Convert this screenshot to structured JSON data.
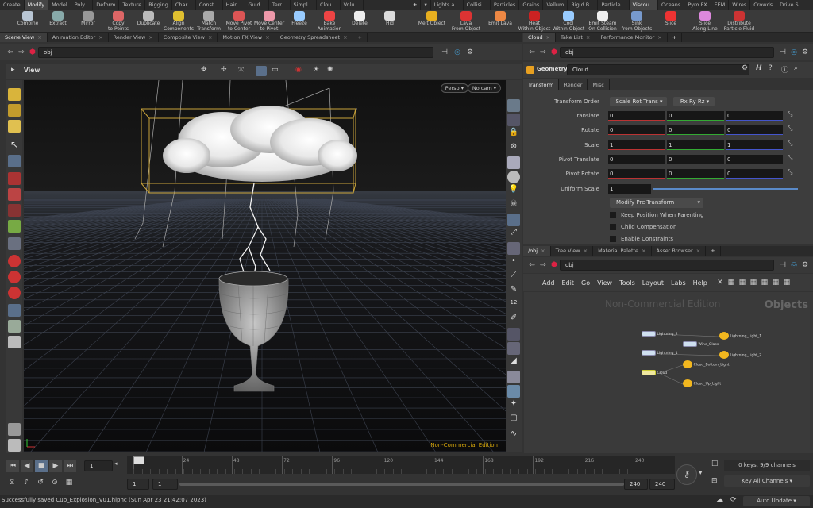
{
  "shelf": {
    "tabs_left": [
      "Create",
      "Modify",
      "Model",
      "Poly...",
      "Deform",
      "Texture",
      "Rigging",
      "Char...",
      "Const...",
      "Hair...",
      "Guid...",
      "Terr...",
      "Simpl...",
      "Clou...",
      "Volu..."
    ],
    "tabs_right": [
      "Lights a...",
      "Collisi...",
      "Particles",
      "Grains",
      "Vellum",
      "Rigid B...",
      "Particle...",
      "Viscou...",
      "Oceans",
      "Pyro FX",
      "FEM",
      "Wires",
      "Crowds",
      "Drive S..."
    ],
    "active_left": "Modify",
    "active_right": "Viscou...",
    "tools_left": [
      {
        "label": "Combine",
        "icon": "combine-icon"
      },
      {
        "label": "Extract",
        "icon": "extract-icon"
      },
      {
        "label": "Mirror",
        "icon": "mirror-icon"
      },
      {
        "label": "Copy\nto Points",
        "icon": "copy-to-points-icon"
      },
      {
        "label": "Duplicate",
        "icon": "duplicate-icon"
      },
      {
        "label": "Align\nComponents",
        "icon": "align-icon"
      },
      {
        "label": "Match\nTransform",
        "icon": "match-transform-icon"
      },
      {
        "label": "Move Pivot\nto Center",
        "icon": "move-pivot-icon"
      },
      {
        "label": "Move Center\nto Pivot",
        "icon": "move-center-icon"
      },
      {
        "label": "Freeze",
        "icon": "freeze-icon"
      },
      {
        "label": "Bake\nAnimation",
        "icon": "bake-icon"
      },
      {
        "label": "Delete",
        "icon": "delete-icon"
      },
      {
        "label": "Hid",
        "icon": "hide-icon"
      }
    ],
    "tools_right": [
      {
        "label": "Melt Object",
        "icon": "melt-icon"
      },
      {
        "label": "Lava\nFrom Object",
        "icon": "lava-icon"
      },
      {
        "label": "Emit Lava",
        "icon": "emit-lava-icon"
      },
      {
        "label": "Heat\nWithin Object",
        "icon": "heat-icon"
      },
      {
        "label": "Cool\nWithin Object",
        "icon": "cool-icon"
      },
      {
        "label": "Emit Steam\nOn Collision",
        "icon": "steam-icon"
      },
      {
        "label": "Sink\nfrom Objects",
        "icon": "sink-icon"
      },
      {
        "label": "Slice",
        "icon": "slice-icon"
      },
      {
        "label": "Slice\nAlong Line",
        "icon": "slice-line-icon"
      },
      {
        "label": "Distribute\nParticle Fluid",
        "icon": "distribute-icon"
      }
    ]
  },
  "left_pane": {
    "tabs": [
      "Scene View",
      "Animation Editor",
      "Render View",
      "Composite View",
      "Motion FX View",
      "Geometry Spreadsheet"
    ],
    "path": "obj",
    "view_label": "View",
    "persp": "Persp",
    "cam": "No cam",
    "watermark": "Non-Commercial Edition"
  },
  "right_top": {
    "tabs": [
      "Cloud",
      "Take List",
      "Performance Monitor"
    ],
    "path": "obj",
    "node_type": "Geometry",
    "node_name": "Cloud",
    "param_tabs": [
      "Transform",
      "Render",
      "Misc"
    ],
    "params": {
      "transform_order_label": "Transform Order",
      "transform_order": "Scale Rot Trans",
      "rot_order": "Rx Ry Rz",
      "translate_label": "Translate",
      "translate": [
        "0",
        "0",
        "0"
      ],
      "rotate_label": "Rotate",
      "rotate": [
        "0",
        "0",
        "0"
      ],
      "scale_label": "Scale",
      "scale": [
        "1",
        "1",
        "1"
      ],
      "pivot_translate_label": "Pivot Translate",
      "pivot_translate": [
        "0",
        "0",
        "0"
      ],
      "pivot_rotate_label": "Pivot Rotate",
      "pivot_rotate": [
        "0",
        "0",
        "0"
      ],
      "uniform_scale_label": "Uniform Scale",
      "uniform_scale": "1",
      "modify_pre_transform": "Modify Pre-Transform",
      "keep_position": "Keep Position When Parenting",
      "child_compensation": "Child Compensation",
      "enable_constraints": "Enable Constraints"
    }
  },
  "right_bottom": {
    "tabs": [
      "/obj",
      "Tree View",
      "Material Palette",
      "Asset Browser"
    ],
    "path": "obj",
    "menu": [
      "Add",
      "Edit",
      "Go",
      "View",
      "Tools",
      "Layout",
      "Labs",
      "Help"
    ],
    "watermark": "Non-Commercial Edition",
    "context": "Objects",
    "nodes": [
      {
        "name": "Lightning_2",
        "kind": "geo"
      },
      {
        "name": "Lightning_1",
        "kind": "geo"
      },
      {
        "name": "Cloud",
        "kind": "geo"
      },
      {
        "name": "Wine_Glass",
        "kind": "geo"
      },
      {
        "name": "Lightning_Light_1",
        "kind": "light"
      },
      {
        "name": "Lightning_Light_2",
        "kind": "light"
      },
      {
        "name": "Cloud_Bottom_Light",
        "kind": "light"
      },
      {
        "name": "Cloud_Up_Light",
        "kind": "light"
      }
    ]
  },
  "timeline": {
    "frame": "1",
    "ticks": [
      "1",
      "24",
      "48",
      "72",
      "96",
      "120",
      "144",
      "168",
      "192",
      "216",
      "240"
    ],
    "range_start": "1",
    "range_start2": "1",
    "range_end": "240",
    "range_end2": "240",
    "keys_info": "0 keys, 9/9 channels",
    "key_all": "Key All Channels",
    "current_frame_fraction": 0.0
  },
  "status": {
    "message": "Successfully saved Cup_Explosion_V01.hipnc (Sun Apr 23 21:42:07 2023)",
    "auto_update": "Auto Update"
  }
}
